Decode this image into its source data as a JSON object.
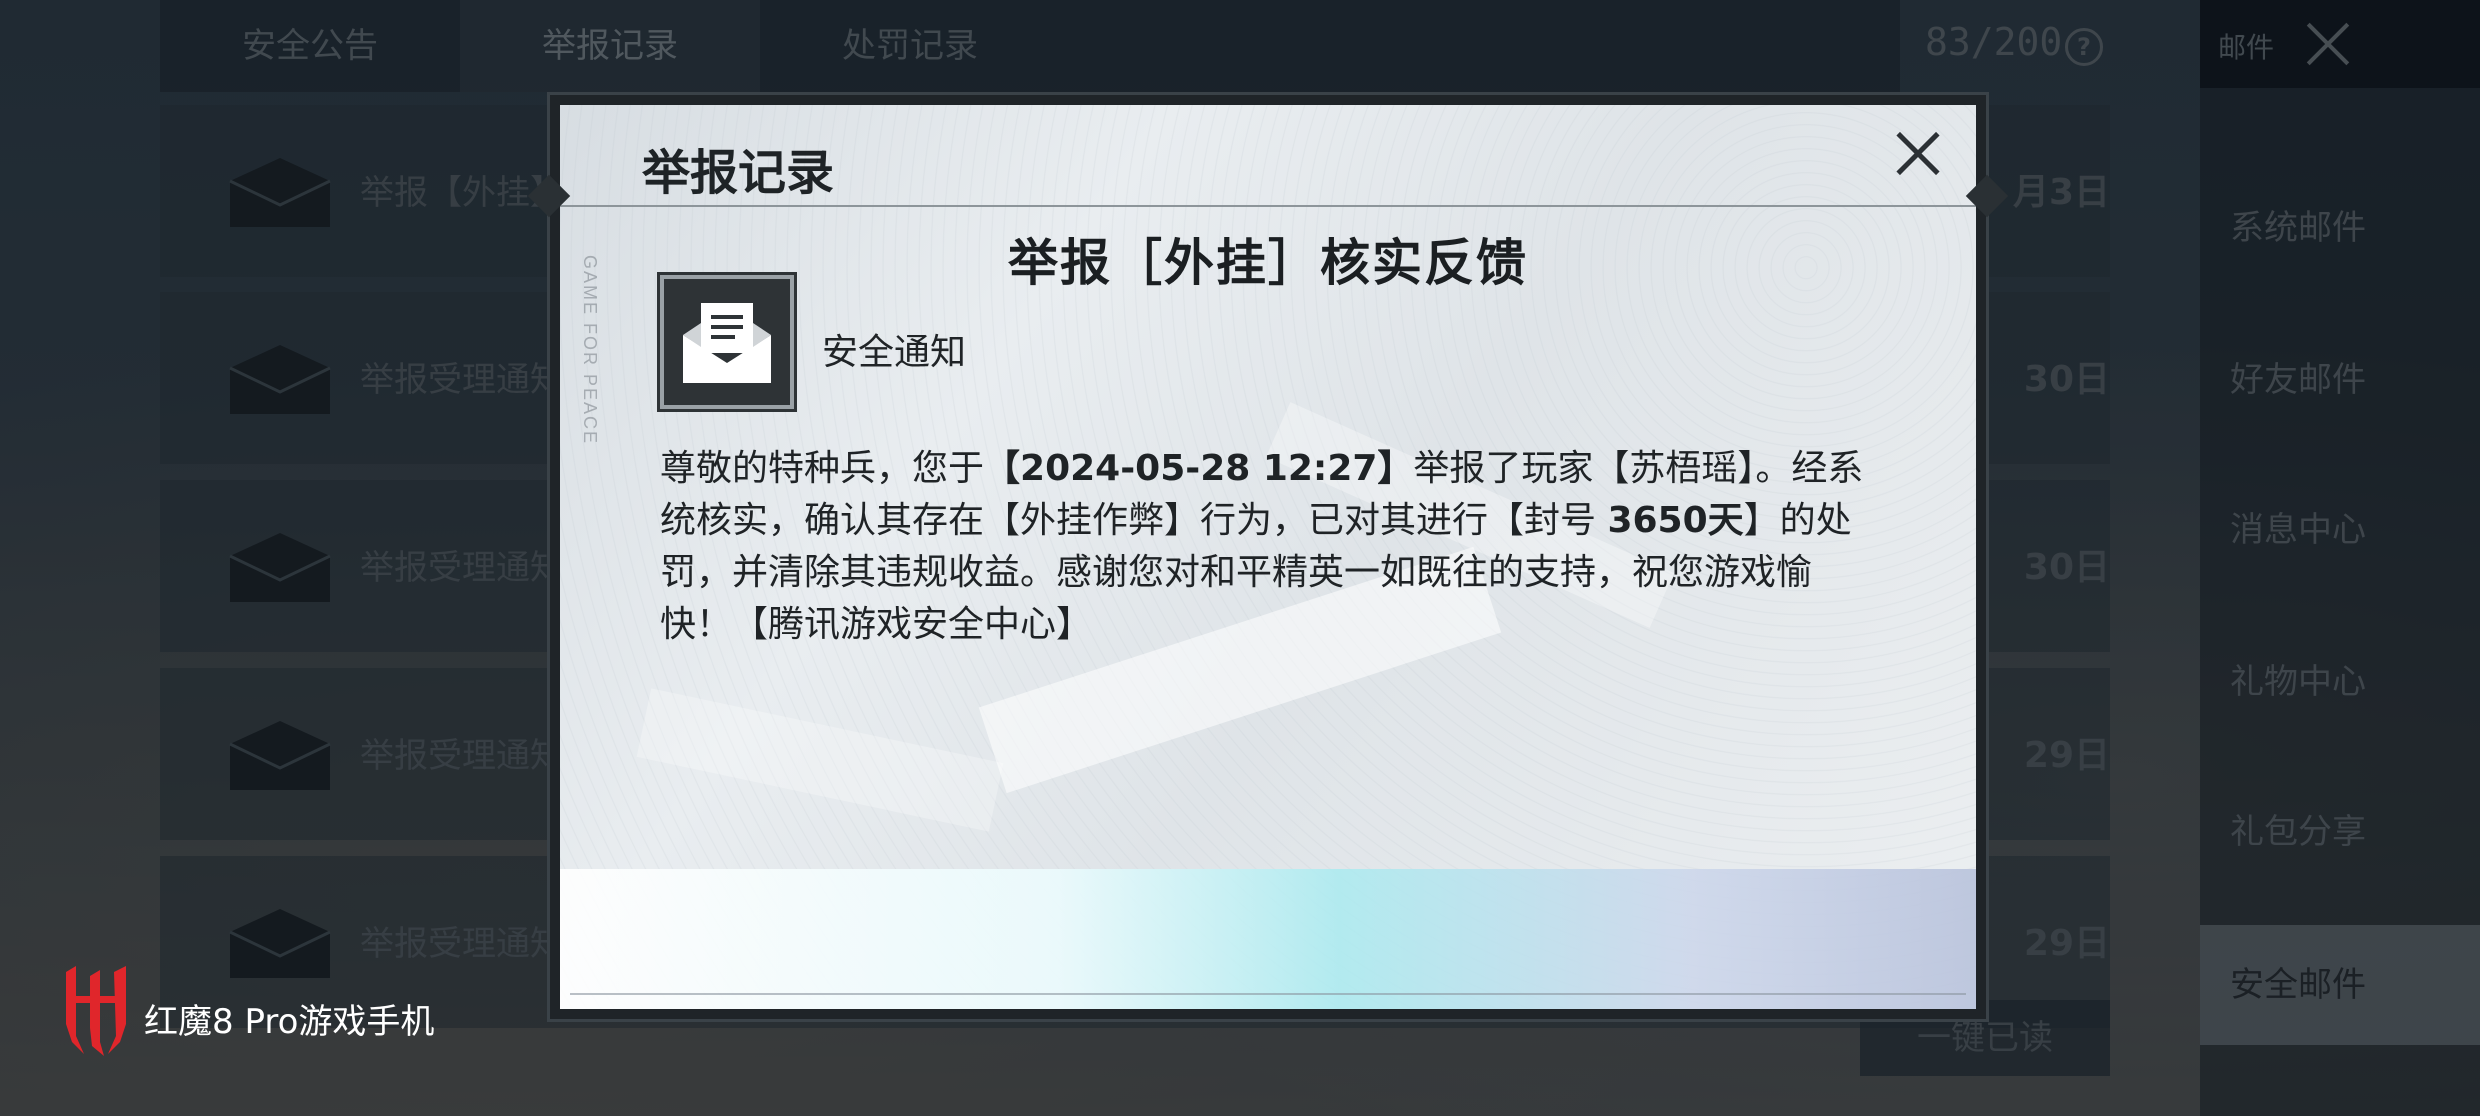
{
  "background": {
    "tabs": [
      "安全公告",
      "举报记录",
      "处罚记录"
    ],
    "active_tab_index": 1,
    "counter": "83/200",
    "right_panel": {
      "header_label": "邮件",
      "items": [
        "系统邮件",
        "好友邮件",
        "消息中心",
        "礼物中心",
        "礼包分享",
        "安全邮件"
      ],
      "active_item_index": 5
    },
    "mail_rows": [
      {
        "title": "举报【外挂】",
        "date": "月3日"
      },
      {
        "title": "举报受理通知",
        "date": "30日"
      },
      {
        "title": "举报受理通知",
        "date": "30日"
      },
      {
        "title": "举报受理通知",
        "date": "29日"
      },
      {
        "title": "举报受理通知",
        "date": "29日"
      }
    ],
    "read_all_button": "一键已读"
  },
  "modal": {
    "title": "举报记录",
    "notice_title": "举报［外挂］核实反馈",
    "sender": "安全通知",
    "vertical_text": "GAME FOR PEACE",
    "body": {
      "p1": "尊敬的特种兵，您于",
      "datetime": "【2024-05-28 12:27】",
      "p2": "举报了玩家【苏梧瑶】。经系统核实，确认其存在【外挂作弊】行为，已对其进行【封号 ",
      "ban_days": "3650天",
      "p3": "】的处罚，并清除其违规收益。感谢您对和平精英一如既往的支持，祝您游戏愉快！【腾讯游戏安全中心】"
    }
  },
  "watermark": {
    "text": "红魔8 Pro游戏手机"
  },
  "colors": {
    "watermark_red": "#e0262b",
    "modal_bg": "#e4e8eb"
  }
}
